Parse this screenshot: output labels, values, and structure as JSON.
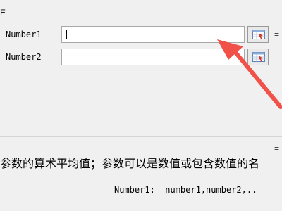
{
  "group": {
    "title": "E"
  },
  "args": [
    {
      "label": "Number1",
      "value": "",
      "result": "="
    },
    {
      "label": "Number2",
      "value": "",
      "result": "="
    }
  ],
  "function_result": "=",
  "description": "参数的算术平均值；参数可以是数值或包含数值的名",
  "arg_info": "Number1:  number1,number2,..",
  "colors": {
    "annotation_arrow": "#f0524a",
    "background": "#f0f0f0"
  },
  "icons": {
    "ref_button": "collapse-dialog-icon"
  }
}
